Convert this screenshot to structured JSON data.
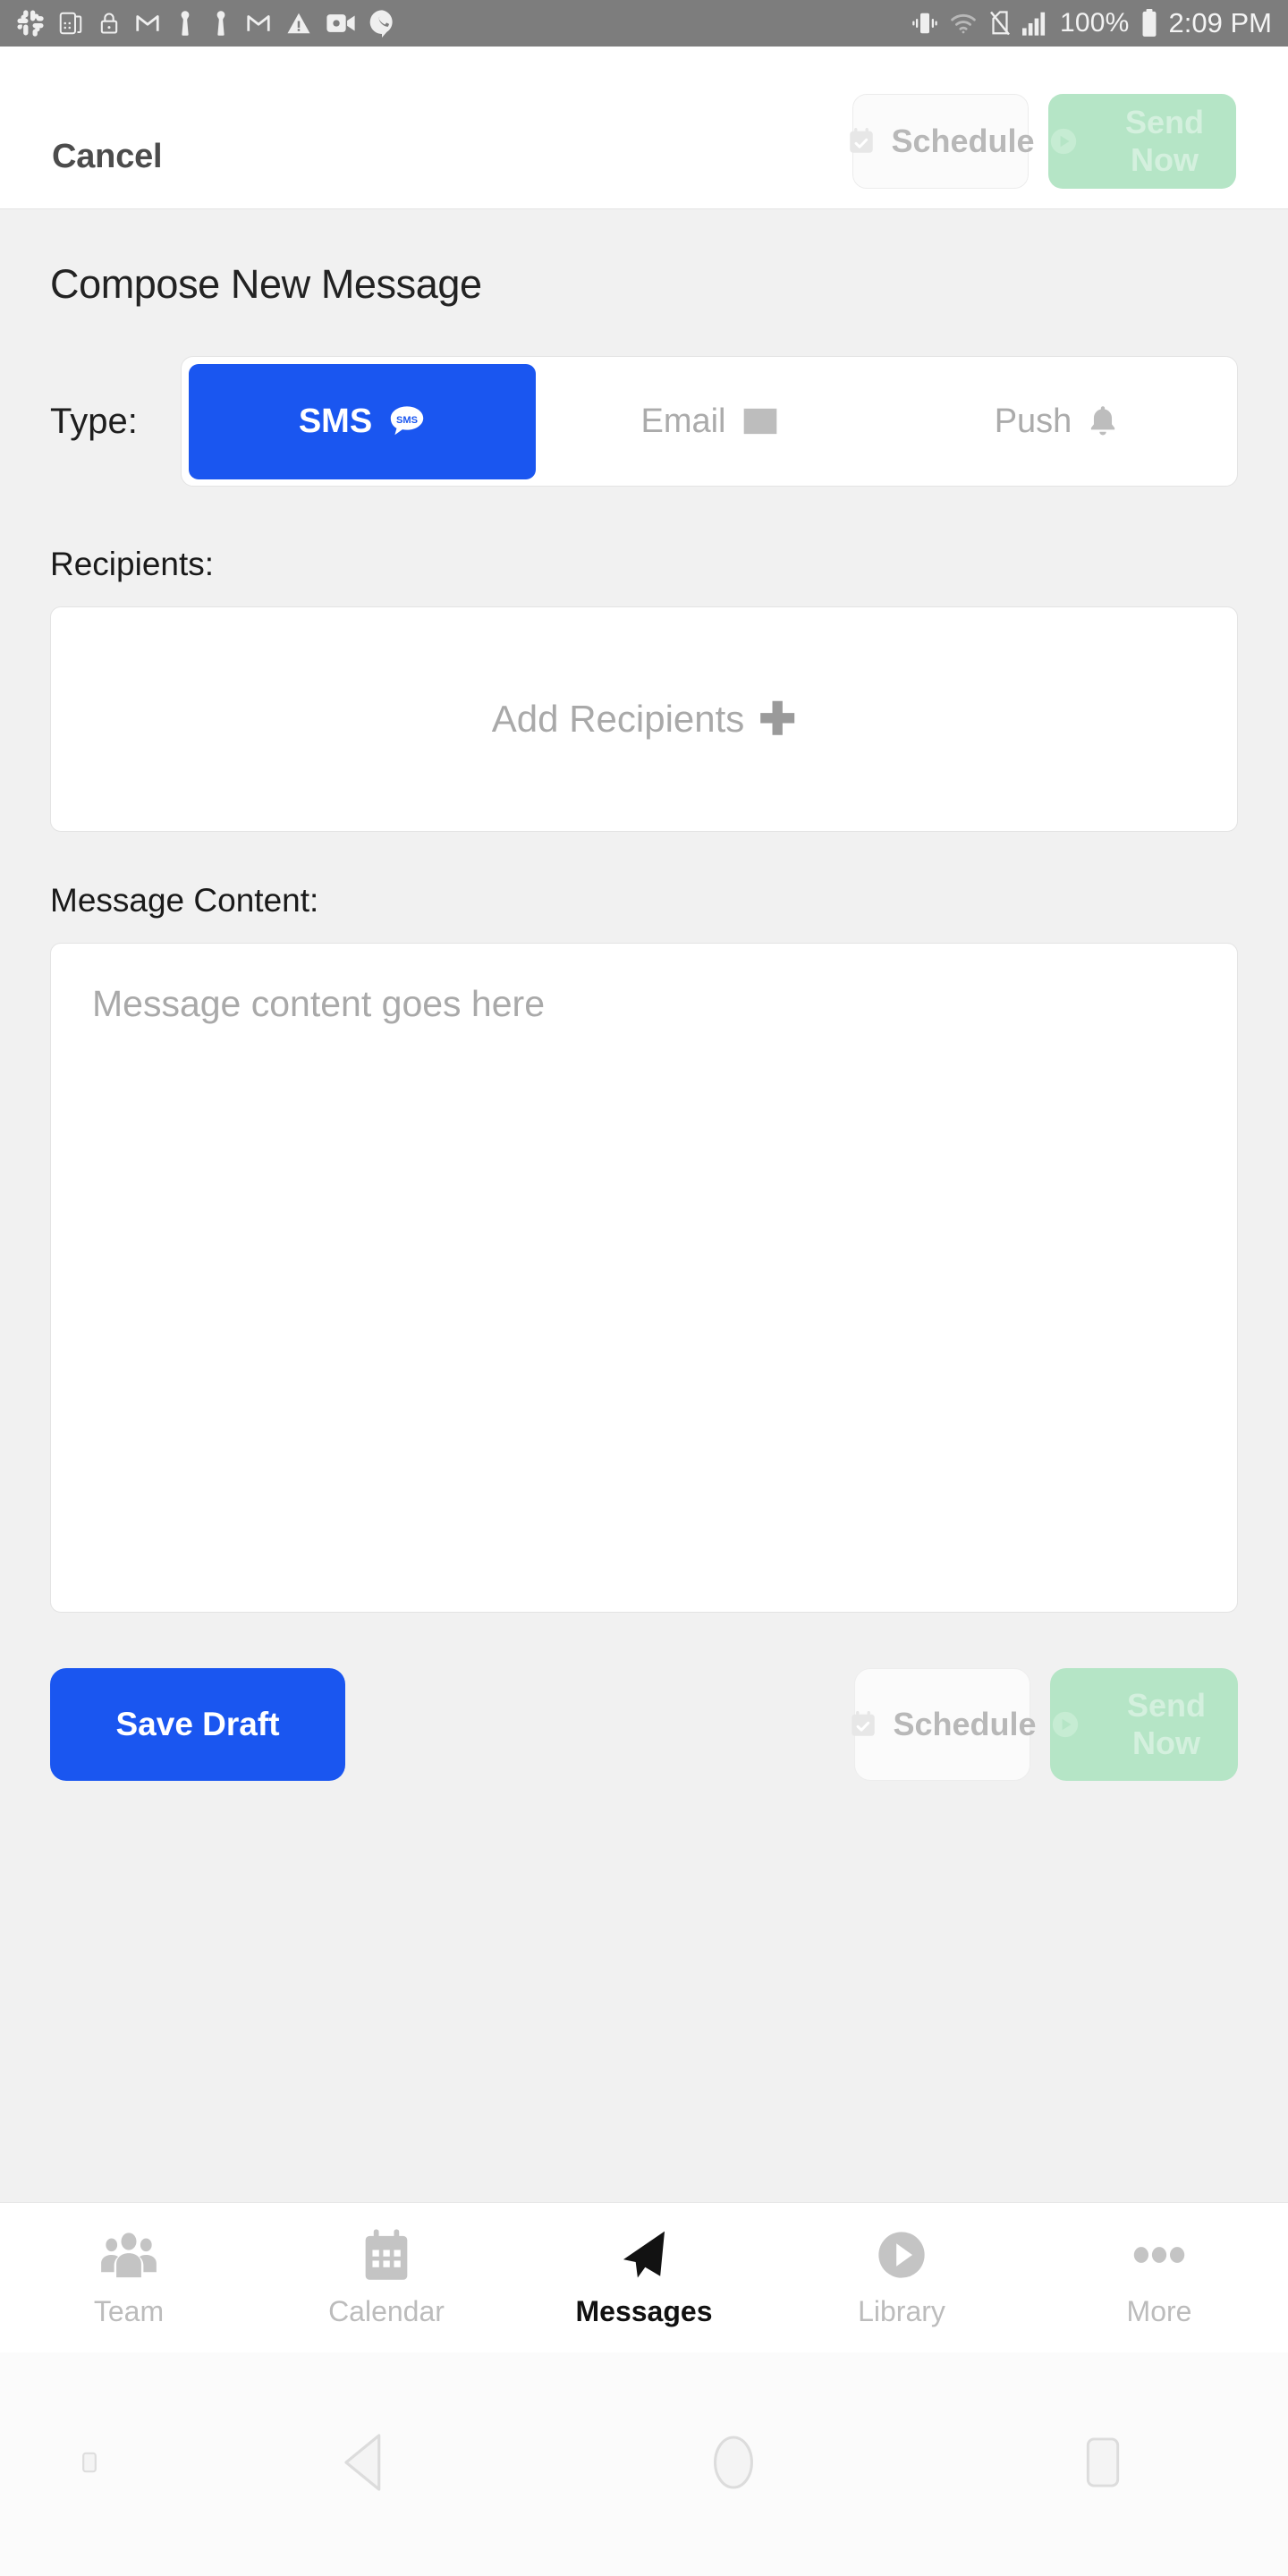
{
  "status_bar": {
    "left_icons": [
      {
        "name": "slack-icon",
        "label": "Slack"
      },
      {
        "name": "keypad-icon",
        "label": "Keypad"
      },
      {
        "name": "lock-icon",
        "label": "Screen lock"
      },
      {
        "name": "gmail-icon",
        "label": "Gmail"
      },
      {
        "name": "person-icon",
        "label": "Contact"
      },
      {
        "name": "person-icon-2",
        "label": "Contact"
      },
      {
        "name": "gmail-icon-2",
        "label": "Gmail"
      },
      {
        "name": "warning-icon",
        "label": "Warning"
      },
      {
        "name": "video-camera-icon",
        "label": "Video"
      },
      {
        "name": "hangouts-call-icon",
        "label": "Call"
      }
    ],
    "right_icons": [
      {
        "name": "vibrate-icon",
        "label": "Vibrate"
      },
      {
        "name": "wifi-icon",
        "label": "Wi-Fi"
      },
      {
        "name": "no-sim-icon",
        "label": "No SIM"
      },
      {
        "name": "signal-bars-icon",
        "label": "Signal"
      }
    ],
    "battery_percent": "100%",
    "battery_icon": "battery-full-icon",
    "time": "2:09 PM"
  },
  "topbar": {
    "cancel_label": "Cancel",
    "schedule_label": "Schedule",
    "schedule_icon": "calendar-check-icon",
    "send_label": "Send Now",
    "send_icon": "play-circle-icon"
  },
  "main": {
    "title": "Compose New Message",
    "type": {
      "label": "Type:",
      "options": [
        {
          "label": "SMS",
          "icon": "sms-bubble-icon",
          "selected": true
        },
        {
          "label": "Email",
          "icon": "envelope-icon",
          "selected": false
        },
        {
          "label": "Push",
          "icon": "bell-icon",
          "selected": false
        }
      ]
    },
    "recipients": {
      "label": "Recipients:",
      "placeholder": "Add Recipients",
      "add_icon": "plus-icon",
      "value": ""
    },
    "message": {
      "label": "Message Content:",
      "placeholder": "Message content goes here",
      "value": ""
    },
    "actions": {
      "save_draft_label": "Save Draft",
      "schedule_label": "Schedule",
      "schedule_icon": "calendar-check-icon",
      "send_label": "Send Now",
      "send_icon": "play-circle-icon"
    }
  },
  "tabbar": {
    "tabs": [
      {
        "label": "Team",
        "icon": "people-group-icon",
        "active": false
      },
      {
        "label": "Calendar",
        "icon": "calendar-icon",
        "active": false
      },
      {
        "label": "Messages",
        "icon": "paper-plane-icon",
        "active": true
      },
      {
        "label": "Library",
        "icon": "play-circle-outline-icon",
        "active": false
      },
      {
        "label": "More",
        "icon": "ellipsis-icon",
        "active": false
      }
    ]
  },
  "navbar": {
    "keyboard_icon": "keyboard-hide-icon",
    "back_icon": "back-triangle-icon",
    "home_icon": "home-circle-icon",
    "recents_icon": "recents-square-icon"
  },
  "colors": {
    "accent_blue": "#1a56f0",
    "send_green": "#b5e5c6",
    "page_bg": "#f1f1f1",
    "statusbar_bg": "#7d7d7d"
  }
}
